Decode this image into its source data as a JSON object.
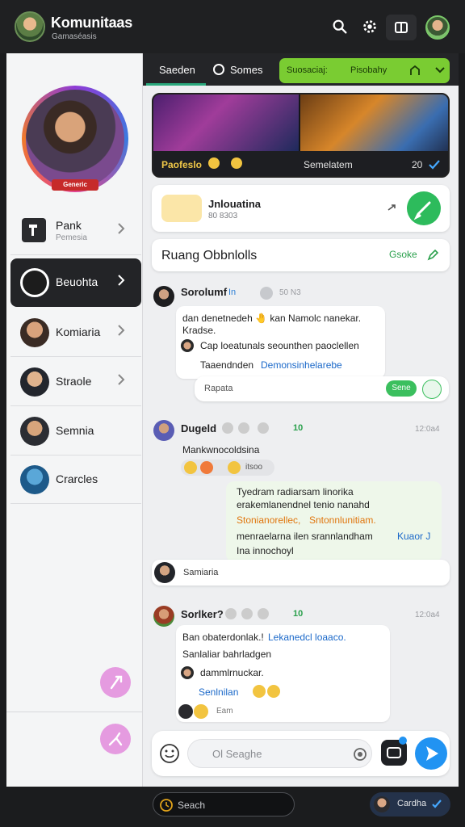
{
  "header": {
    "title": "Komunitaas",
    "subtitle": "Gamaséasis",
    "icons": [
      "search-icon",
      "settings-icon",
      "layout-icon"
    ]
  },
  "sidebar": {
    "profile_tag": "Generic",
    "items": [
      {
        "label": "Pank",
        "sub": "Pemesia",
        "icon": "tile-icon"
      },
      {
        "label": "Beuohta",
        "icon": "avatar"
      },
      {
        "label": "Komiaria",
        "icon": "avatar"
      },
      {
        "label": "Straole",
        "icon": "avatar"
      },
      {
        "label": "Semnia",
        "icon": "avatar"
      },
      {
        "label": "Crarcles",
        "icon": "avatar"
      }
    ]
  },
  "main": {
    "tabs": [
      {
        "label": "Saeden"
      },
      {
        "label": "Somes"
      }
    ],
    "green_bar": {
      "left": "Suosaciaj:",
      "right": "Pisobahy"
    },
    "banner": {
      "left_label": "Paofeslo",
      "right_label": "Semelatem",
      "count": "20"
    },
    "join_card": {
      "title": "Jnlouatina",
      "subtitle": "80 8303"
    },
    "room": {
      "title": "Ruang Obbnlolls",
      "link": "Gsoke"
    },
    "messages": [
      {
        "name": "Sorolumf",
        "badge": "In",
        "time": "50 N3",
        "lines": [
          "dan denetnedeh 🤚 kan Namolc nanekar.",
          "Kradse.",
          "Cap loeatunals seounthen paoclellen",
          "Taaendnden"
        ],
        "link": "Demonsinhelarebe",
        "reply_placeholder": "Rapata",
        "reply_button": "Sene"
      },
      {
        "name": "Dugeld",
        "count": "10",
        "time": "12:0a4",
        "line": "Mankwnocoldsina",
        "reaction_label": "itsoo",
        "reply_lines": [
          "Tyedram radiarsam linorika",
          "erakemlanendnel tenio nanahd",
          "Stonianorellec,",
          "Sntonnlunitiam.",
          "menraelarna ilen srannlandham",
          "Ina innochoyl"
        ],
        "reply_side": "Kuaor J",
        "footer": "Samiaria"
      },
      {
        "name": "Sorlker?",
        "count": "10",
        "time": "12:0a4",
        "line1_a": "Ban obaterdonlak.!",
        "line1_b": "Lekanedcl loaaco.",
        "line2": "Sanlaliar bahrladgen",
        "line3": "dammlrnuckar.",
        "link": "Senlnilan",
        "footer": "Eam"
      }
    ],
    "composer": {
      "placeholder": "Ol  Seaghe"
    }
  },
  "bottom": {
    "search": "Seach",
    "right": "Cardha"
  },
  "colors": {
    "accent_green": "#7acc32",
    "accent_blue": "#2193f2",
    "dark": "#1b1c1e"
  }
}
